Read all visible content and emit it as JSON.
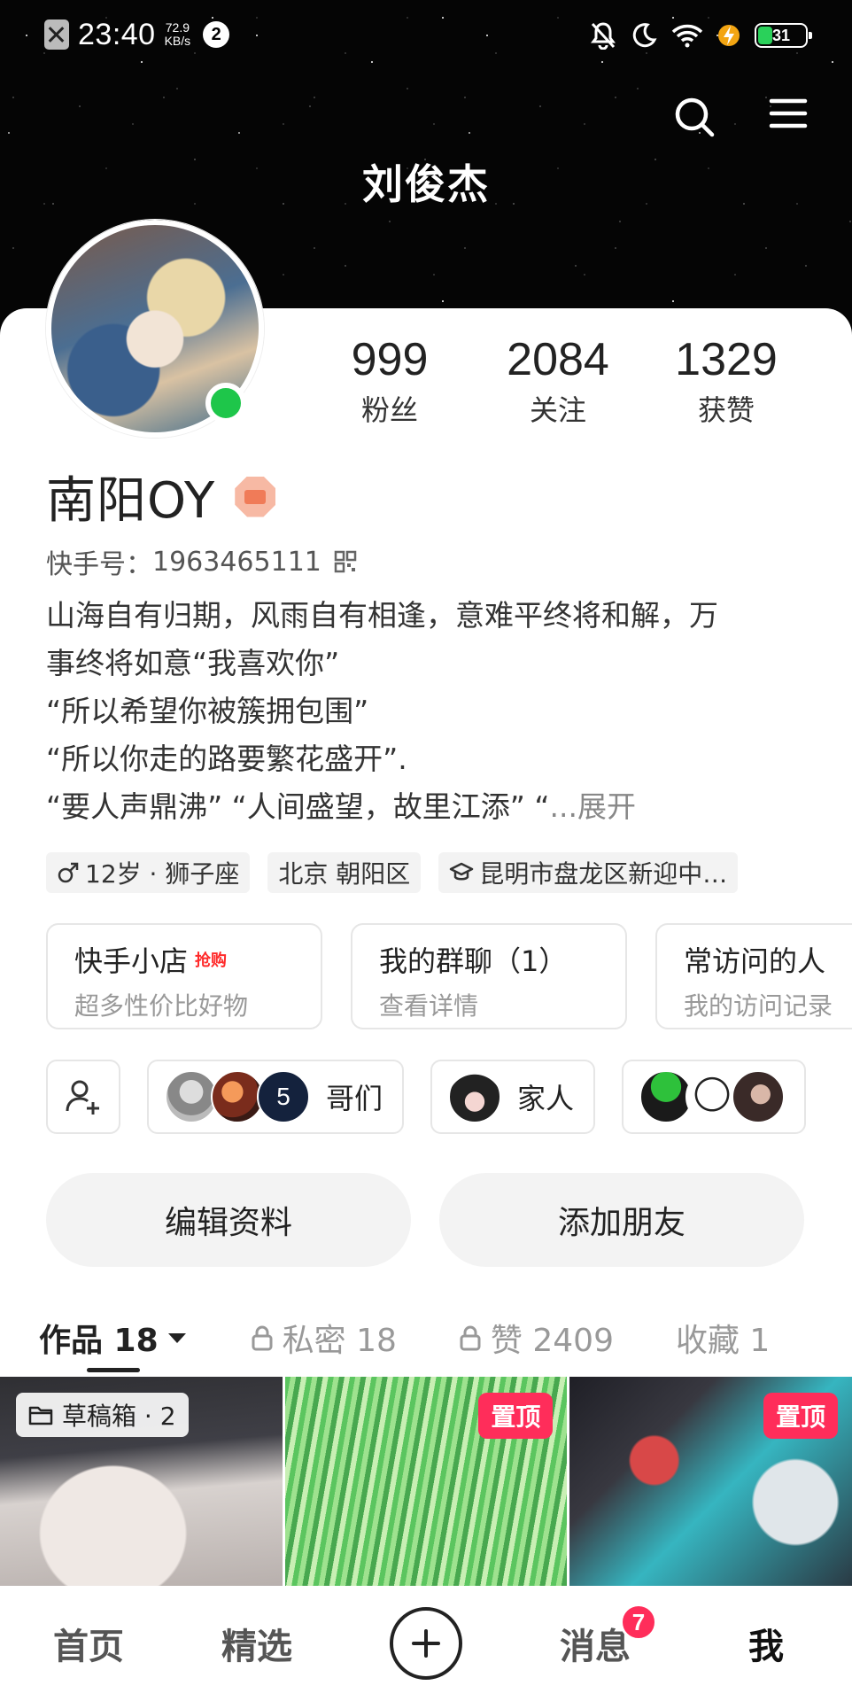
{
  "status_bar": {
    "time": "23:40",
    "speed_value": "72.9",
    "speed_unit": "KB/s",
    "notification_count": "2",
    "battery": "31",
    "battery_level_percent": 31,
    "battery_color": "#2ad15a"
  },
  "header": {
    "display_name": "刘俊杰",
    "icons": [
      "search-icon",
      "menu-icon"
    ]
  },
  "profile": {
    "online": true,
    "stats": [
      {
        "value": "999",
        "label": "粉丝"
      },
      {
        "value": "2084",
        "label": "关注"
      },
      {
        "value": "1329",
        "label": "获赞"
      }
    ],
    "name": "南阳OY",
    "id_label": "快手号：",
    "id_value": "1963465111",
    "bio_lines": [
      "山海自有归期，风雨自有相逢，意难平终将和解，万",
      "事终将如意“我喜欢你”",
      "“所以希望你被簇拥包围”",
      "“所以你走的路要繁花盛开”.",
      "“要人声鼎沸” “人间盛望，故里江添” “"
    ],
    "bio_expand": "...展开",
    "tags": [
      {
        "text": "12岁 · 狮子座",
        "icon": "male-icon"
      },
      {
        "text": "北京 朝阳区",
        "icon": ""
      },
      {
        "text": "昆明市盘龙区新迎中…",
        "icon": "school-icon"
      }
    ]
  },
  "feature_cards": [
    {
      "title": "快手小店",
      "hot": "抢购",
      "subtitle": "超多性价比好物"
    },
    {
      "title": "我的群聊（1）",
      "hot": "",
      "subtitle": "查看详情"
    },
    {
      "title": "常访问的人",
      "hot": "",
      "subtitle": "我的访问记录"
    }
  ],
  "groups": [
    {
      "name": "哥们",
      "extra_count": "5"
    },
    {
      "name": "家人",
      "extra_count": ""
    },
    {
      "name": "",
      "extra_count": ""
    }
  ],
  "buttons": {
    "edit_profile": "编辑资料",
    "add_friend": "添加朋友"
  },
  "tabs": [
    {
      "label": "作品 18",
      "locked": false,
      "active": true
    },
    {
      "label": "私密 18",
      "locked": true,
      "active": false
    },
    {
      "label": "赞 2409",
      "locked": true,
      "active": false
    },
    {
      "label": "收藏 1",
      "locked": false,
      "active": false
    }
  ],
  "works": {
    "draft_label": "草稿箱 · 2",
    "pin_label": "置顶"
  },
  "bottom_nav": {
    "home": "首页",
    "featured": "精选",
    "messages": "消息",
    "messages_badge": "7",
    "me": "我"
  },
  "colors": {
    "accent_pink": "#ff2d5a",
    "online_green": "#1ec64a",
    "hot_red": "#ff2a2a"
  }
}
